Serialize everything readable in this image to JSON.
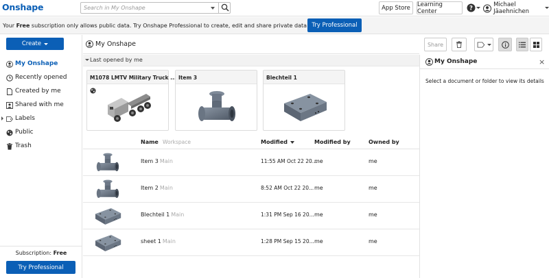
{
  "app": {
    "logo": "Onshape"
  },
  "search": {
    "placeholder": "Search in My Onshape"
  },
  "topbar": {
    "app_store": "App Store",
    "learning_center": "Learning Center",
    "user_name": "Michael Jäaehnichen"
  },
  "banner": {
    "prefix": "Your ",
    "plan": "Free",
    "message": " subscription only allows public data. Try Onshape Professional to create, edit and share private data with your team.",
    "button": "Try Professional"
  },
  "sidebar": {
    "create_label": "Create",
    "items": [
      {
        "label": "My Onshape",
        "icon": "user-icon",
        "active": true
      },
      {
        "label": "Recently opened",
        "icon": "clock-icon",
        "active": false
      },
      {
        "label": "Created by me",
        "icon": "document-icon",
        "active": false
      },
      {
        "label": "Shared with me",
        "icon": "shared-icon",
        "active": false
      },
      {
        "label": "Labels",
        "icon": "label-icon",
        "active": false
      },
      {
        "label": "Public",
        "icon": "globe-icon",
        "active": false
      },
      {
        "label": "Trash",
        "icon": "trash-icon",
        "active": false
      }
    ],
    "subscription_label": "Subscription:",
    "subscription_value": "Free",
    "try_button": "Try Professional"
  },
  "main": {
    "breadcrumb": "My Onshape",
    "share_label": "Share",
    "recent_header": "Last opened by me",
    "recent_cards": [
      {
        "title": "M1078 LMTV Military Truck ...",
        "public": true,
        "thumb": "truck"
      },
      {
        "title": "Item 3",
        "public": false,
        "thumb": "tee"
      },
      {
        "title": "Blechteil 1",
        "public": false,
        "thumb": "plate"
      }
    ],
    "columns": {
      "name": "Name",
      "workspace": "Workspace",
      "modified": "Modified",
      "modified_by": "Modified by",
      "owned_by": "Owned by"
    },
    "rows": [
      {
        "name": "Item 3",
        "workspace": "Main",
        "modified": "11:55 AM Oct 22 20...",
        "modified_by": "me",
        "owned_by": "me",
        "thumb": "tee"
      },
      {
        "name": "Item 2",
        "workspace": "Main",
        "modified": "8:52 AM Oct 22 20...",
        "modified_by": "me",
        "owned_by": "me",
        "thumb": "tee"
      },
      {
        "name": "Blechteil 1",
        "workspace": "Main",
        "modified": "1:31 PM Sep 16 20...",
        "modified_by": "me",
        "owned_by": "me",
        "thumb": "plate"
      },
      {
        "name": "sheet 1",
        "workspace": "Main",
        "modified": "1:28 PM Sep 15 20...",
        "modified_by": "me",
        "owned_by": "me",
        "thumb": "plate"
      }
    ]
  },
  "details_panel": {
    "title": "My Onshape",
    "message": "Select a document or folder to view its details"
  },
  "colors": {
    "brand": "#0b5fb6",
    "accent_bg": "#f4f4f4"
  }
}
